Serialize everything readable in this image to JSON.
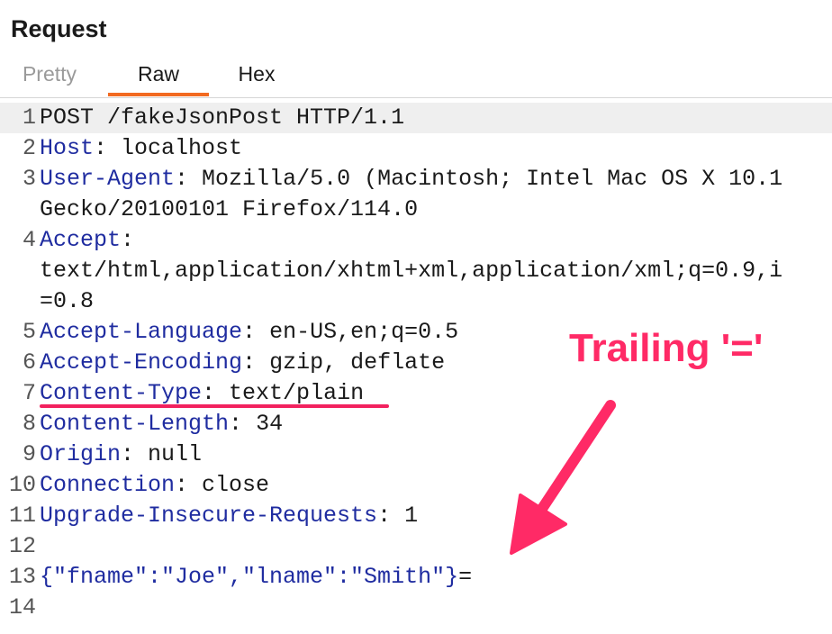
{
  "panel": {
    "title": "Request"
  },
  "tabs": [
    {
      "label": "Pretty",
      "active": false
    },
    {
      "label": "Raw",
      "active": true
    },
    {
      "label": "Hex",
      "active": false
    }
  ],
  "colors": {
    "accent_tab": "#f26a21",
    "header_name": "#1f2ca0",
    "annotation": "#ff2a66"
  },
  "lines": [
    {
      "n": "1",
      "request_line": "POST /fakeJsonPost HTTP/1.1"
    },
    {
      "n": "2",
      "name": "Host",
      "value": " localhost"
    },
    {
      "n": "3",
      "name": "User-Agent",
      "value": " Mozilla/5.0 (Macintosh; Intel Mac OS X 10.1",
      "wrap": "Gecko/20100101 Firefox/114.0"
    },
    {
      "n": "4",
      "name": "Accept",
      "value": "",
      "wrap": "text/html,application/xhtml+xml,application/xml;q=0.9,i",
      "wrap2": "=0.8"
    },
    {
      "n": "5",
      "name": "Accept-Language",
      "value": " en-US,en;q=0.5"
    },
    {
      "n": "6",
      "name": "Accept-Encoding",
      "value": " gzip, deflate"
    },
    {
      "n": "7",
      "name": "Content-Type",
      "value": " text/plain"
    },
    {
      "n": "8",
      "name": "Content-Length",
      "value": " 34"
    },
    {
      "n": "9",
      "name": "Origin",
      "value": " null"
    },
    {
      "n": "10",
      "name": "Connection",
      "value": " close"
    },
    {
      "n": "11",
      "name": "Upgrade-Insecure-Requests",
      "value": " 1"
    },
    {
      "n": "12"
    },
    {
      "n": "13",
      "body": "{\"fname\":\"Joe\",\"lname\":\"Smith\"}",
      "suffix": "="
    },
    {
      "n": "14"
    }
  ],
  "annotation": {
    "text": "Trailing '='"
  }
}
